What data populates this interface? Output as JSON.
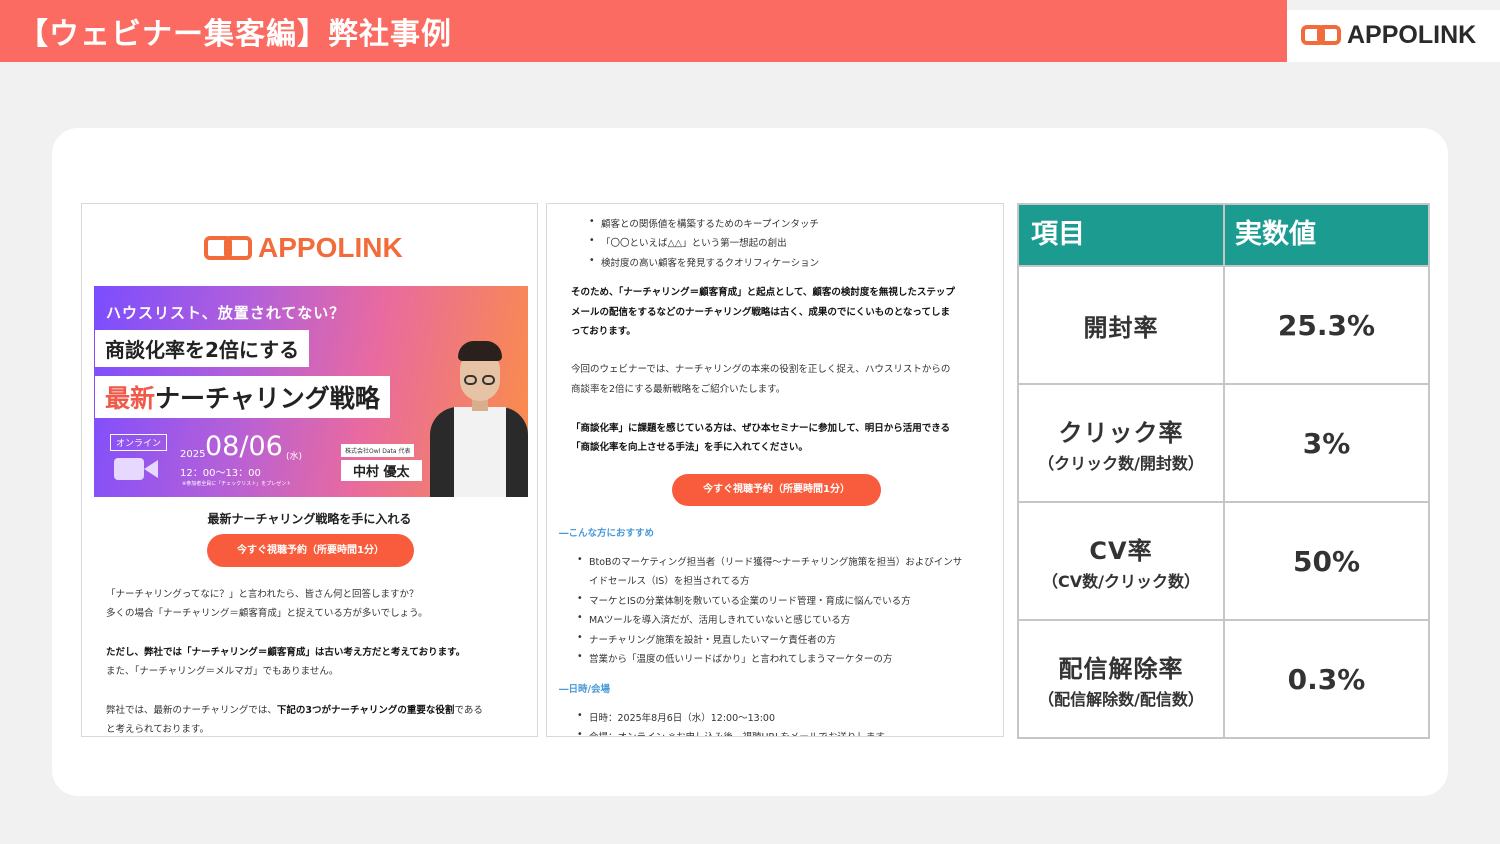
{
  "header": {
    "title": "【ウェビナー集客編】弊社事例",
    "logo_text": "APPOLINK"
  },
  "lp": {
    "logo_text": "APPOLINK",
    "banner": {
      "line1": "ハウスリスト、放置されてない？",
      "line2": "商談化率を2倍にする",
      "line3_highlight": "最新",
      "line3_rest": "ナーチャリング戦略",
      "online_badge": "オンライン",
      "year": "2025",
      "date": "08/06",
      "day_of_week": "(水)",
      "time": "12：00〜13：00",
      "note": "※参加者全員に「チェックリスト」をプレゼント",
      "company": "株式会社Owl Data 代表",
      "speaker": "中村 優太"
    },
    "heading": "最新ナーチャリング戦略を手に入れる",
    "cta": "今すぐ視聴予約（所要時間1分）",
    "body": {
      "p1_l1": "「ナーチャリングってなに？」と言われたら、皆さん何と回答しますか？",
      "p1_l2": "多くの場合「ナーチャリング＝顧客育成」と捉えている方が多いでしょう。",
      "p2_l1": "ただし、弊社では「ナーチャリング＝顧客育成」は古い考え方だと考えております。",
      "p2_l2": "また、「ナーチャリング＝メルマガ」でもありません。",
      "p3_l1_a": "弊社では、最新のナーチャリングでは、",
      "p3_l1_b": "下記の3つがナーチャリングの重要な役割",
      "p3_l1_c": "である",
      "p3_l2": "と考えられております。"
    }
  },
  "lp2": {
    "bullets_top": [
      "顧客との関係値を構築するためのキープインタッチ",
      "「〇〇といえば△△」という第一想起の創出",
      "検討度の高い顧客を発見するクオリフィケーション"
    ],
    "para1_l1": "そのため、「ナーチャリング＝顧客育成」と起点として、顧客の検討度を無視したステップ",
    "para1_l2": "メールの配信をするなどのナーチャリング戦略は古く、成果のでにくいものとなってしま",
    "para1_l3": "っております。",
    "para2_l1": "今回のウェビナーでは、ナーチャリングの本来の役割を正しく捉え、ハウスリストからの",
    "para2_l2": "商談率を2倍にする最新戦略をご紹介いたします。",
    "para3_l1": "「商談化率」に課題を感じている方は、ぜひ本セミナーに参加して、明日から活用できる",
    "para3_l2": "「商談化率を向上させる手法」を手に入れてください。",
    "cta": "今すぐ視聴予約（所要時間1分）",
    "section_recommend": "―こんな方におすすめ",
    "recommend": [
      "BtoBのマーケティング担当者（リード獲得〜ナーチャリング施策を担当）およびインサ",
      "イドセールス（IS）を担当されてる方",
      "マーケとISの分業体制を敷いている企業のリード管理・育成に悩んでいる方",
      "MAツールを導入済だが、活用しきれていないと感じている方",
      "ナーチャリング施策を設計・見直したいマーケ責任者の方",
      "営業から「温度の低いリードばかり」と言われてしまうマーケターの方"
    ],
    "section_date": "―日時/会場",
    "date_line": "日時：2025年8月6日（水）12:00〜13:00",
    "venue_line": "会場：オンライン ※お申し込み後、視聴URLをメールでお送りします"
  },
  "table": {
    "header_item": "項目",
    "header_value": "実数値",
    "rows": [
      {
        "label": "開封率",
        "sub": "",
        "value": "25.3%"
      },
      {
        "label": "クリック率",
        "sub": "（クリック数/開封数）",
        "value": "3%"
      },
      {
        "label": "CV率",
        "sub": "（CV数/クリック数）",
        "value": "50%"
      },
      {
        "label": "配信解除率",
        "sub": "（配信解除数/配信数）",
        "value": "0.3%"
      }
    ]
  },
  "colors": {
    "header_bar": "#fb6b62",
    "table_header": "#1c9c91",
    "cta": "#f95c3c",
    "logo_orange": "#f26b3b",
    "section_blue": "#4a9ad8"
  }
}
